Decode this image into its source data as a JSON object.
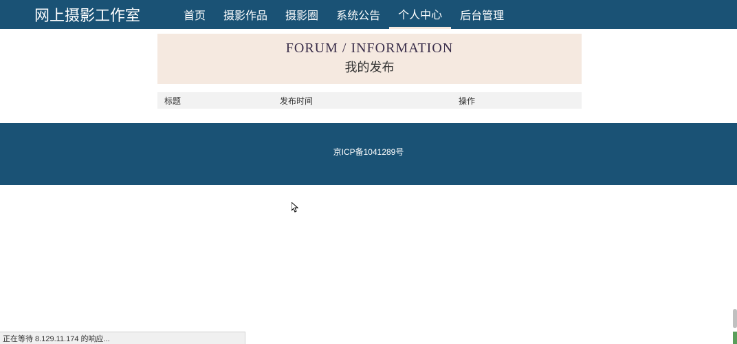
{
  "header": {
    "logo": "网上摄影工作室",
    "nav": [
      {
        "label": "首页",
        "active": false
      },
      {
        "label": "摄影作品",
        "active": false
      },
      {
        "label": "摄影圈",
        "active": false
      },
      {
        "label": "系统公告",
        "active": false
      },
      {
        "label": "个人中心",
        "active": true
      },
      {
        "label": "后台管理",
        "active": false
      }
    ]
  },
  "page": {
    "title_en": "FORUM / INFORMATION",
    "title_cn": "我的发布",
    "columns": {
      "title": "标题",
      "time": "发布时间",
      "action": "操作"
    }
  },
  "footer": {
    "icp": "京ICP备1041289号"
  },
  "status": {
    "text": "正在等待 8.129.11.174 的响应..."
  }
}
